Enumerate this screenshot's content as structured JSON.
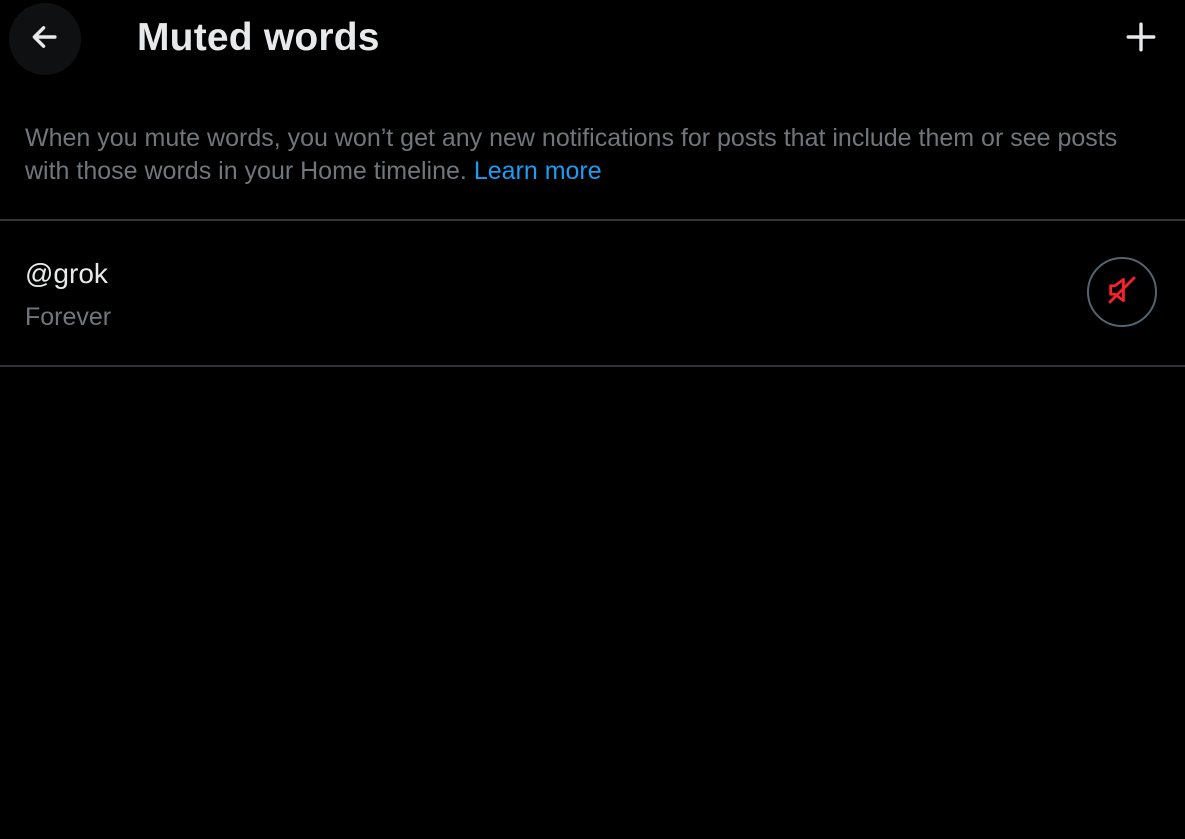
{
  "header": {
    "title": "Muted words",
    "back_icon": "arrow-left-icon",
    "add_icon": "plus-icon"
  },
  "description": {
    "text": "When you mute words, you won’t get any new notifications for posts that include them or see posts with those words in your Home timeline.",
    "link_label": "Learn more"
  },
  "muted_words": [
    {
      "word": "@grok",
      "duration": "Forever",
      "action_icon": "speaker-muted-icon"
    }
  ],
  "colors": {
    "background": "#000000",
    "primary_text": "#e7e9ea",
    "secondary_text": "#71767b",
    "link": "#1d9bf0",
    "unmute_icon": "#f4212e",
    "divider": "#2f3336"
  }
}
